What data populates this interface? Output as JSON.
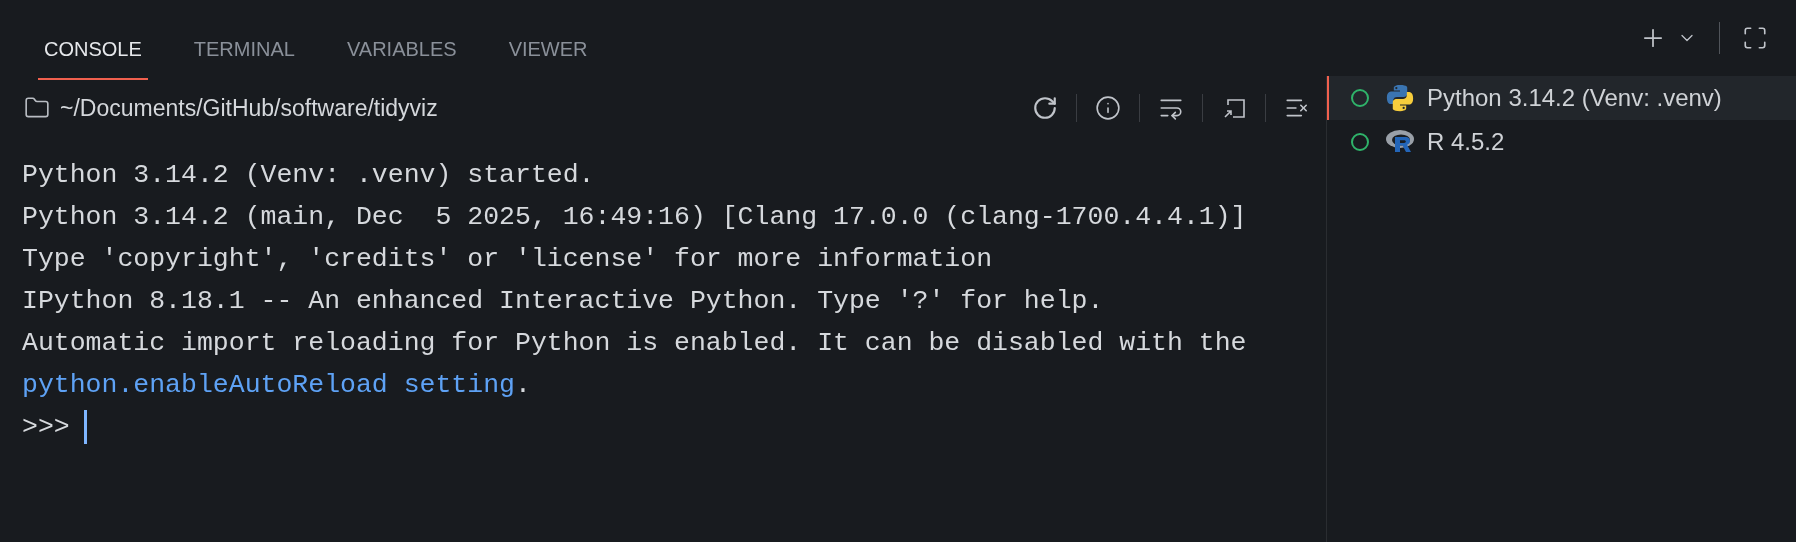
{
  "tabs": [
    {
      "label": "CONSOLE",
      "selected": true
    },
    {
      "label": "TERMINAL",
      "selected": false
    },
    {
      "label": "VARIABLES",
      "selected": false
    },
    {
      "label": "VIEWER",
      "selected": false
    }
  ],
  "path": "~/Documents/GitHub/software/tidyviz",
  "console": {
    "lines": [
      {
        "kind": "text",
        "text": "Python 3.14.2 (Venv: .venv) started."
      },
      {
        "kind": "text",
        "text": "Python 3.14.2 (main, Dec  5 2025, 16:49:16) [Clang 17.0.0 (clang-1700.4.4.1)]"
      },
      {
        "kind": "text",
        "text": "Type 'copyright', 'credits' or 'license' for more information"
      },
      {
        "kind": "text",
        "text": "IPython 8.18.1 -- An enhanced Interactive Python. Type '?' for help."
      },
      {
        "kind": "text",
        "text": "Automatic import reloading for Python is enabled. It can be disabled with the"
      },
      {
        "kind": "link",
        "link": "python.enableAutoReload setting",
        "text": "."
      }
    ],
    "prompt": ">>>"
  },
  "sessions": [
    {
      "kind": "python",
      "label": "Python 3.14.2 (Venv: .venv)",
      "selected": true
    },
    {
      "kind": "r",
      "label": "R 4.5.2",
      "selected": false
    }
  ]
}
